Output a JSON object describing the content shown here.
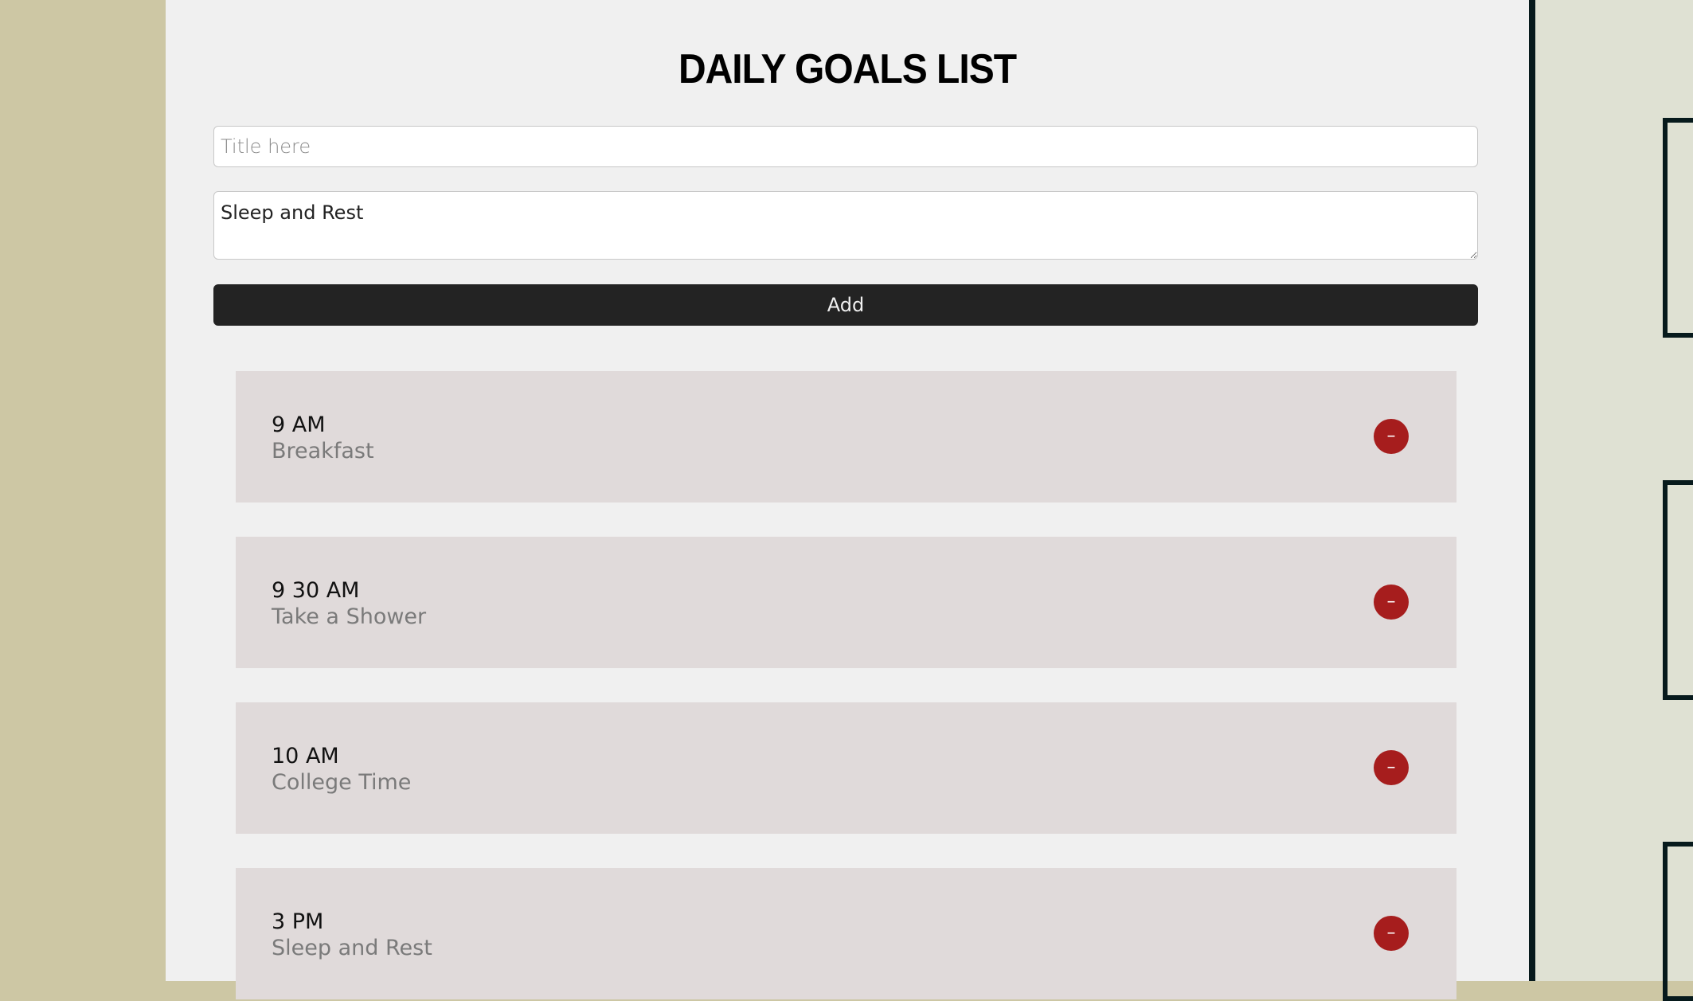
{
  "header": {
    "title": "DAILY GOALS LIST"
  },
  "form": {
    "title_placeholder": "Title here",
    "title_value": "",
    "description_value": "Sleep and Rest",
    "add_label": "Add"
  },
  "goals": [
    {
      "time": "9 AM",
      "description": "Breakfast",
      "remove_label": "–"
    },
    {
      "time": "9 30 AM",
      "description": "Take a Shower",
      "remove_label": "–"
    },
    {
      "time": "10 AM",
      "description": "College Time",
      "remove_label": "–"
    },
    {
      "time": "3 PM",
      "description": "Sleep and Rest",
      "remove_label": "–"
    }
  ],
  "colors": {
    "side_background": "#cdc7a4",
    "panel_background": "#f0f0f0",
    "card_background": "#e0dada",
    "button_dark": "#232323",
    "remove_red": "#a61d1d",
    "divider": "#071a1c",
    "right_panel": "#dfe1d3"
  }
}
